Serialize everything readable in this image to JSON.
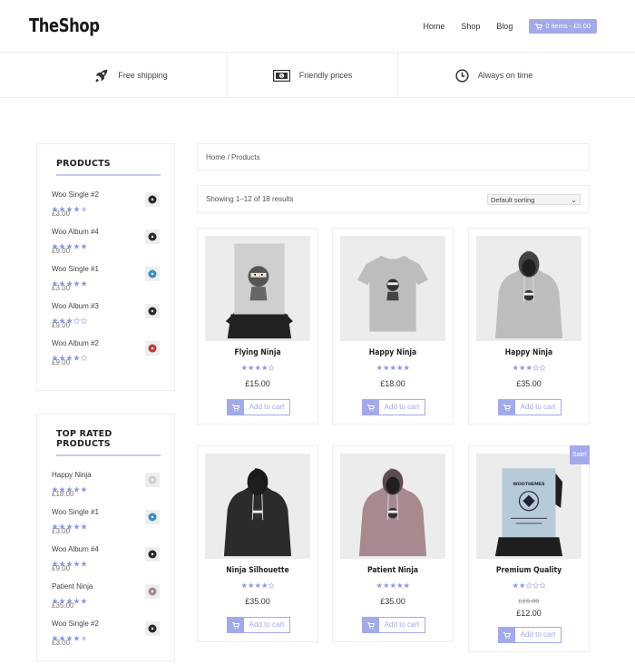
{
  "header": {
    "logo": "TheShop",
    "nav": [
      "Home",
      "Shop",
      "Blog"
    ],
    "cart_label": "0 items - £0.00"
  },
  "features": [
    {
      "label": "Free shipping",
      "icon": "rocket-icon"
    },
    {
      "label": "Friendly prices",
      "icon": "money-icon"
    },
    {
      "label": "Always on time",
      "icon": "clock-icon"
    }
  ],
  "sidebar": {
    "products": {
      "title": "PRODUCTS",
      "items": [
        {
          "name": "Woo Single #2",
          "price": "£3.00",
          "rating": 4.5,
          "thumb": "dark"
        },
        {
          "name": "Woo Album #4",
          "price": "£9.00",
          "rating": 5,
          "thumb": "dark"
        },
        {
          "name": "Woo Single #1",
          "price": "£3.00",
          "rating": 5,
          "thumb": "blue"
        },
        {
          "name": "Woo Album #3",
          "price": "£9.00",
          "rating": 3,
          "thumb": "dark"
        },
        {
          "name": "Woo Album #2",
          "price": "£9.00",
          "rating": 4,
          "thumb": "red"
        }
      ]
    },
    "top_rated": {
      "title": "TOP RATED PRODUCTS",
      "items": [
        {
          "name": "Happy Ninja",
          "price": "£18.00",
          "rating": 5,
          "thumb": "grey"
        },
        {
          "name": "Woo Single #1",
          "price": "£3.00",
          "rating": 5,
          "thumb": "blue"
        },
        {
          "name": "Woo Album #4",
          "price": "£9.00",
          "rating": 5,
          "thumb": "dark"
        },
        {
          "name": "Patient Ninja",
          "price": "£35.00",
          "rating": 5,
          "thumb": "pink"
        },
        {
          "name": "Woo Single #2",
          "price": "£3.00",
          "rating": 4.5,
          "thumb": "dark"
        }
      ]
    }
  },
  "breadcrumb": {
    "home": "Home",
    "sep": " / ",
    "current": "Products"
  },
  "results": "Showing 1–12 of 18 results",
  "sort": {
    "selected": "Default sorting"
  },
  "add_to_cart": "Add to cart",
  "sale_badge": "Sale!",
  "products": [
    {
      "name": "Flying Ninja",
      "price": "£15.00",
      "rating": 4,
      "image": "poster-ninja"
    },
    {
      "name": "Happy Ninja",
      "price": "£18.00",
      "rating": 5,
      "image": "tshirt-grey"
    },
    {
      "name": "Happy Ninja",
      "price": "£35.00",
      "rating": 3,
      "image": "hoodie-grey"
    },
    {
      "name": "Ninja Silhouette",
      "price": "£35.00",
      "rating": 4,
      "image": "hoodie-black"
    },
    {
      "name": "Patient Ninja",
      "price": "£35.00",
      "rating": 5,
      "image": "hoodie-pink"
    },
    {
      "name": "Premium Quality",
      "price": "£12.00",
      "old_price": "£15.00",
      "rating": 2,
      "image": "poster-woo",
      "sale": true
    }
  ],
  "colors": {
    "accent": "#a2aaea",
    "star": "#8f98e6",
    "border": "#eeeeee"
  }
}
